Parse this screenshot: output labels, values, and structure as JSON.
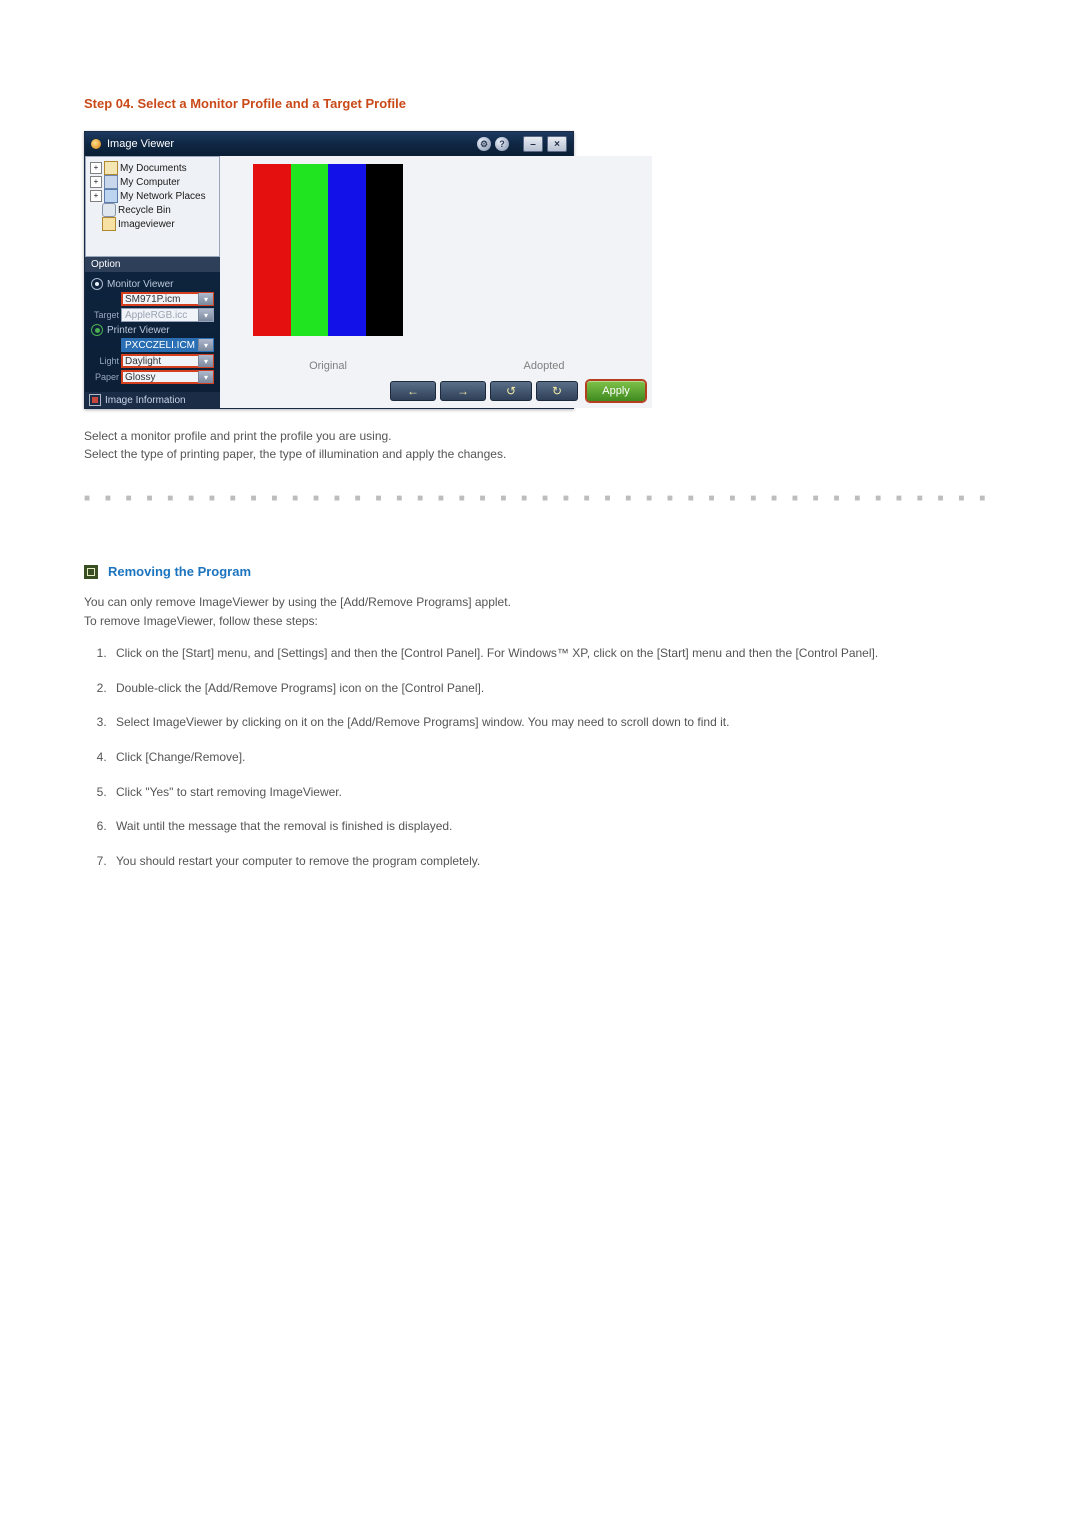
{
  "heading": "Step 04. Select a Monitor Profile and a Target Profile",
  "app": {
    "title": "Image Viewer",
    "title_buttons": {
      "settings": "⚙",
      "help": "?",
      "minimize": "–",
      "close": "×"
    },
    "tree": {
      "items": [
        {
          "label": "My Documents",
          "expandable": true
        },
        {
          "label": "My Computer",
          "expandable": true
        },
        {
          "label": "My Network Places",
          "expandable": true
        },
        {
          "label": "Recycle Bin",
          "expandable": false
        },
        {
          "label": "Imageviewer",
          "expandable": false
        }
      ]
    },
    "option": {
      "header": "Option",
      "monitor_viewer_label": "Monitor Viewer",
      "monitor_profile": "SM971P.icm",
      "target_label": "Target",
      "target_profile": "AppleRGB.icc",
      "printer_viewer_label": "Printer Viewer",
      "printer_profile": "PXCCZELI.ICM",
      "light_label": "Light",
      "light_value": "Daylight",
      "paper_label": "Paper",
      "paper_value": "Glossy",
      "image_info_label": "Image Information"
    },
    "captions": {
      "original": "Original",
      "adopted": "Adopted"
    },
    "toolbar": {
      "back": "←",
      "forward": "→",
      "rotate_ccw": "↺",
      "rotate_cw": "↻",
      "apply": "Apply"
    }
  },
  "body": {
    "line1": "Select a monitor profile and print the profile you are using.",
    "line2": "Select the type of printing paper, the type of illumination and apply the changes."
  },
  "section2": {
    "title": "Removing the Program",
    "para1": "You can only remove ImageViewer by using the [Add/Remove Programs] applet.",
    "para2": "To remove ImageViewer, follow these steps:",
    "steps": [
      "Click on the [Start] menu, and [Settings] and then the [Control Panel]. For Windows™ XP, click on the [Start] menu and then the [Control Panel].",
      "Double-click the [Add/Remove Programs] icon on the [Control Panel].",
      "Select ImageViewer by clicking on it on the [Add/Remove Programs] window. You may need to scroll down to find it.",
      "Click [Change/Remove].",
      "Click \"Yes\" to start removing ImageViewer.",
      "Wait until the message that the removal is finished is displayed.",
      "You should restart your computer to remove the program completely."
    ]
  },
  "divider": "■ ■ ■ ■ ■ ■ ■ ■ ■ ■ ■ ■ ■ ■ ■ ■ ■ ■ ■ ■ ■ ■ ■ ■ ■ ■ ■ ■ ■ ■ ■ ■ ■ ■ ■ ■ ■ ■ ■ ■ ■ ■ ■ ■ ■"
}
